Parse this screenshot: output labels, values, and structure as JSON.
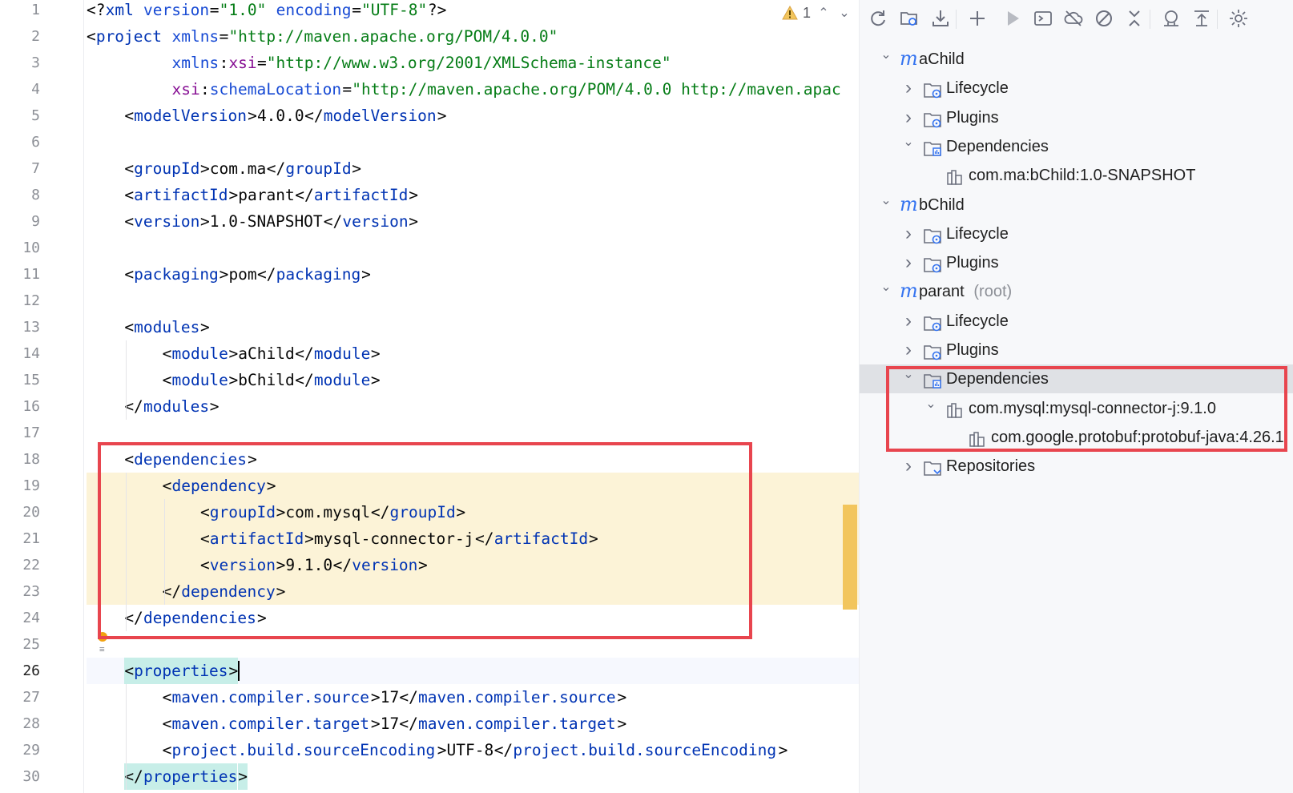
{
  "editor": {
    "status": {
      "warning_count": "1"
    },
    "lines": [
      {
        "n": "1",
        "indent": 0,
        "tokens": [
          [
            "punc",
            "<?"
          ],
          [
            "tag",
            "xml"
          ],
          [
            "punc",
            " "
          ],
          [
            "attr",
            "version"
          ],
          [
            "punc",
            "="
          ],
          [
            "val",
            "\"1.0\""
          ],
          [
            "punc",
            " "
          ],
          [
            "attr",
            "encoding"
          ],
          [
            "punc",
            "="
          ],
          [
            "val",
            "\"UTF-8\""
          ],
          [
            "punc",
            "?>"
          ]
        ]
      },
      {
        "n": "2",
        "indent": 0,
        "tokens": [
          [
            "punc",
            "<"
          ],
          [
            "tag",
            "project"
          ],
          [
            "punc",
            " "
          ],
          [
            "attr",
            "xmlns"
          ],
          [
            "punc",
            "="
          ],
          [
            "val",
            "\"http://maven.apache.org/POM/4.0.0\""
          ]
        ]
      },
      {
        "n": "3",
        "indent": 9,
        "tokens": [
          [
            "attr",
            "xmlns"
          ],
          [
            "punc",
            ":"
          ],
          [
            "ns",
            "xsi"
          ],
          [
            "punc",
            "="
          ],
          [
            "val",
            "\"http://www.w3.org/2001/XMLSchema-instance\""
          ]
        ]
      },
      {
        "n": "4",
        "indent": 9,
        "tokens": [
          [
            "ns",
            "xsi"
          ],
          [
            "punc",
            ":"
          ],
          [
            "attr",
            "schemaLocation"
          ],
          [
            "punc",
            "="
          ],
          [
            "val",
            "\"http://maven.apache.org/POM/4.0.0 http://maven.apac"
          ]
        ]
      },
      {
        "n": "5",
        "indent": 4,
        "tokens": [
          [
            "punc",
            "<"
          ],
          [
            "tag",
            "modelVersion"
          ],
          [
            "punc",
            ">"
          ],
          [
            "txt",
            "4.0.0"
          ],
          [
            "punc",
            "</"
          ],
          [
            "tag",
            "modelVersion"
          ],
          [
            "punc",
            ">"
          ]
        ]
      },
      {
        "n": "6",
        "indent": 0,
        "tokens": []
      },
      {
        "n": "7",
        "indent": 4,
        "tokens": [
          [
            "punc",
            "<"
          ],
          [
            "tag",
            "groupId"
          ],
          [
            "punc",
            ">"
          ],
          [
            "txt",
            "com.ma"
          ],
          [
            "punc",
            "</"
          ],
          [
            "tag",
            "groupId"
          ],
          [
            "punc",
            ">"
          ]
        ]
      },
      {
        "n": "8",
        "indent": 4,
        "tokens": [
          [
            "punc",
            "<"
          ],
          [
            "tag",
            "artifactId"
          ],
          [
            "punc",
            ">"
          ],
          [
            "txt",
            "parant"
          ],
          [
            "punc",
            "</"
          ],
          [
            "tag",
            "artifactId"
          ],
          [
            "punc",
            ">"
          ]
        ]
      },
      {
        "n": "9",
        "indent": 4,
        "tokens": [
          [
            "punc",
            "<"
          ],
          [
            "tag",
            "version"
          ],
          [
            "punc",
            ">"
          ],
          [
            "txt",
            "1.0-SNAPSHOT"
          ],
          [
            "punc",
            "</"
          ],
          [
            "tag",
            "version"
          ],
          [
            "punc",
            ">"
          ]
        ]
      },
      {
        "n": "10",
        "indent": 0,
        "tokens": []
      },
      {
        "n": "11",
        "indent": 4,
        "tokens": [
          [
            "punc",
            "<"
          ],
          [
            "tag",
            "packaging"
          ],
          [
            "punc",
            ">"
          ],
          [
            "txt",
            "pom"
          ],
          [
            "punc",
            "</"
          ],
          [
            "tag",
            "packaging"
          ],
          [
            "punc",
            ">"
          ]
        ]
      },
      {
        "n": "12",
        "indent": 0,
        "tokens": []
      },
      {
        "n": "13",
        "indent": 4,
        "tokens": [
          [
            "punc",
            "<"
          ],
          [
            "tag",
            "modules"
          ],
          [
            "punc",
            ">"
          ]
        ]
      },
      {
        "n": "14",
        "indent": 8,
        "tokens": [
          [
            "punc",
            "<"
          ],
          [
            "tag",
            "module"
          ],
          [
            "punc",
            ">"
          ],
          [
            "txt",
            "aChild"
          ],
          [
            "punc",
            "</"
          ],
          [
            "tag",
            "module"
          ],
          [
            "punc",
            ">"
          ]
        ]
      },
      {
        "n": "15",
        "indent": 8,
        "tokens": [
          [
            "punc",
            "<"
          ],
          [
            "tag",
            "module"
          ],
          [
            "punc",
            ">"
          ],
          [
            "txt",
            "bChild"
          ],
          [
            "punc",
            "</"
          ],
          [
            "tag",
            "module"
          ],
          [
            "punc",
            ">"
          ]
        ]
      },
      {
        "n": "16",
        "indent": 4,
        "tokens": [
          [
            "punc",
            "</"
          ],
          [
            "tag",
            "modules"
          ],
          [
            "punc",
            ">"
          ]
        ]
      },
      {
        "n": "17",
        "indent": 0,
        "tokens": []
      },
      {
        "n": "18",
        "indent": 4,
        "tokens": [
          [
            "punc",
            "<"
          ],
          [
            "tag",
            "dependencies"
          ],
          [
            "punc",
            ">"
          ]
        ]
      },
      {
        "n": "19",
        "indent": 8,
        "tokens": [
          [
            "punc",
            "<"
          ],
          [
            "tag",
            "dependency"
          ],
          [
            "punc",
            ">"
          ]
        ]
      },
      {
        "n": "20",
        "indent": 12,
        "tokens": [
          [
            "punc",
            "<"
          ],
          [
            "tag",
            "groupId"
          ],
          [
            "punc",
            ">"
          ],
          [
            "txt",
            "com.mysql"
          ],
          [
            "punc",
            "</"
          ],
          [
            "tag",
            "groupId"
          ],
          [
            "punc",
            ">"
          ]
        ]
      },
      {
        "n": "21",
        "indent": 12,
        "tokens": [
          [
            "punc",
            "<"
          ],
          [
            "tag",
            "artifactId"
          ],
          [
            "punc",
            ">"
          ],
          [
            "txt",
            "mysql-connector-j"
          ],
          [
            "punc",
            "</"
          ],
          [
            "tag",
            "artifactId"
          ],
          [
            "punc",
            ">"
          ]
        ]
      },
      {
        "n": "22",
        "indent": 12,
        "tokens": [
          [
            "punc",
            "<"
          ],
          [
            "tag",
            "version"
          ],
          [
            "punc",
            ">"
          ],
          [
            "txt",
            "9.1.0"
          ],
          [
            "punc",
            "</"
          ],
          [
            "tag",
            "version"
          ],
          [
            "punc",
            ">"
          ]
        ]
      },
      {
        "n": "23",
        "indent": 8,
        "tokens": [
          [
            "punc",
            "</"
          ],
          [
            "tag",
            "dependency"
          ],
          [
            "punc",
            ">"
          ]
        ]
      },
      {
        "n": "24",
        "indent": 4,
        "tokens": [
          [
            "punc",
            "</"
          ],
          [
            "tag",
            "dependencies"
          ],
          [
            "punc",
            ">"
          ]
        ]
      },
      {
        "n": "25",
        "indent": 0,
        "tokens": []
      },
      {
        "n": "26",
        "indent": 4,
        "tokens": [
          [
            "punc",
            "<"
          ],
          [
            "tag",
            "properties"
          ],
          [
            "punc",
            ">"
          ]
        ]
      },
      {
        "n": "27",
        "indent": 8,
        "tokens": [
          [
            "punc",
            "<"
          ],
          [
            "tag",
            "maven.compiler.source"
          ],
          [
            "punc",
            ">"
          ],
          [
            "txt",
            "17"
          ],
          [
            "punc",
            "</"
          ],
          [
            "tag",
            "maven.compiler.source"
          ],
          [
            "punc",
            ">"
          ]
        ]
      },
      {
        "n": "28",
        "indent": 8,
        "tokens": [
          [
            "punc",
            "<"
          ],
          [
            "tag",
            "maven.compiler.target"
          ],
          [
            "punc",
            ">"
          ],
          [
            "txt",
            "17"
          ],
          [
            "punc",
            "</"
          ],
          [
            "tag",
            "maven.compiler.target"
          ],
          [
            "punc",
            ">"
          ]
        ]
      },
      {
        "n": "29",
        "indent": 8,
        "tokens": [
          [
            "punc",
            "<"
          ],
          [
            "tag",
            "project.build.sourceEncoding"
          ],
          [
            "punc",
            ">"
          ],
          [
            "txt",
            "UTF-8"
          ],
          [
            "punc",
            "</"
          ],
          [
            "tag",
            "project.build.sourceEncoding"
          ],
          [
            "punc",
            ">"
          ]
        ]
      },
      {
        "n": "30",
        "indent": 4,
        "tokens": [
          [
            "punc",
            "</"
          ],
          [
            "tag",
            "properties"
          ],
          [
            "punc",
            ">"
          ]
        ]
      }
    ]
  },
  "maven": {
    "toolbar_icons": [
      "reload-icon",
      "generate-sources-icon",
      "download-icon",
      "add-icon",
      "run-icon",
      "execute-goal-icon",
      "offline-icon",
      "skip-tests-icon",
      "collapse-all-icon",
      "analyze-dependencies-icon",
      "show-dependencies-icon",
      "settings-icon"
    ],
    "tree": [
      {
        "level": 0,
        "kind": "module",
        "expanded": true,
        "label": "aChild",
        "suffix": ""
      },
      {
        "level": 1,
        "kind": "folder",
        "expanded": false,
        "label": "Lifecycle"
      },
      {
        "level": 1,
        "kind": "folder",
        "expanded": false,
        "label": "Plugins"
      },
      {
        "level": 1,
        "kind": "deps",
        "expanded": true,
        "label": "Dependencies"
      },
      {
        "level": 2,
        "kind": "lib",
        "leaf": true,
        "label": "com.ma:bChild:1.0-SNAPSHOT"
      },
      {
        "level": 0,
        "kind": "module",
        "expanded": true,
        "label": "bChild",
        "suffix": ""
      },
      {
        "level": 1,
        "kind": "folder",
        "expanded": false,
        "label": "Lifecycle"
      },
      {
        "level": 1,
        "kind": "folder",
        "expanded": false,
        "label": "Plugins"
      },
      {
        "level": 0,
        "kind": "module",
        "expanded": true,
        "label": "parant",
        "suffix": "(root)"
      },
      {
        "level": 1,
        "kind": "folder",
        "expanded": false,
        "label": "Lifecycle"
      },
      {
        "level": 1,
        "kind": "folder",
        "expanded": false,
        "label": "Plugins"
      },
      {
        "level": 1,
        "kind": "deps",
        "expanded": true,
        "label": "Dependencies",
        "selected": true
      },
      {
        "level": 2,
        "kind": "lib",
        "expanded": true,
        "label": "com.mysql:mysql-connector-j:9.1.0"
      },
      {
        "level": 3,
        "kind": "lib",
        "leaf": true,
        "label": "com.google.protobuf:protobuf-java:4.26.1"
      },
      {
        "level": 1,
        "kind": "repo",
        "expanded": false,
        "label": "Repositories"
      }
    ]
  },
  "colors": {
    "accent": "#3574f0",
    "highlight": "#fcf3d7",
    "callout": "#e8454e",
    "marker": "#f2c55c"
  }
}
